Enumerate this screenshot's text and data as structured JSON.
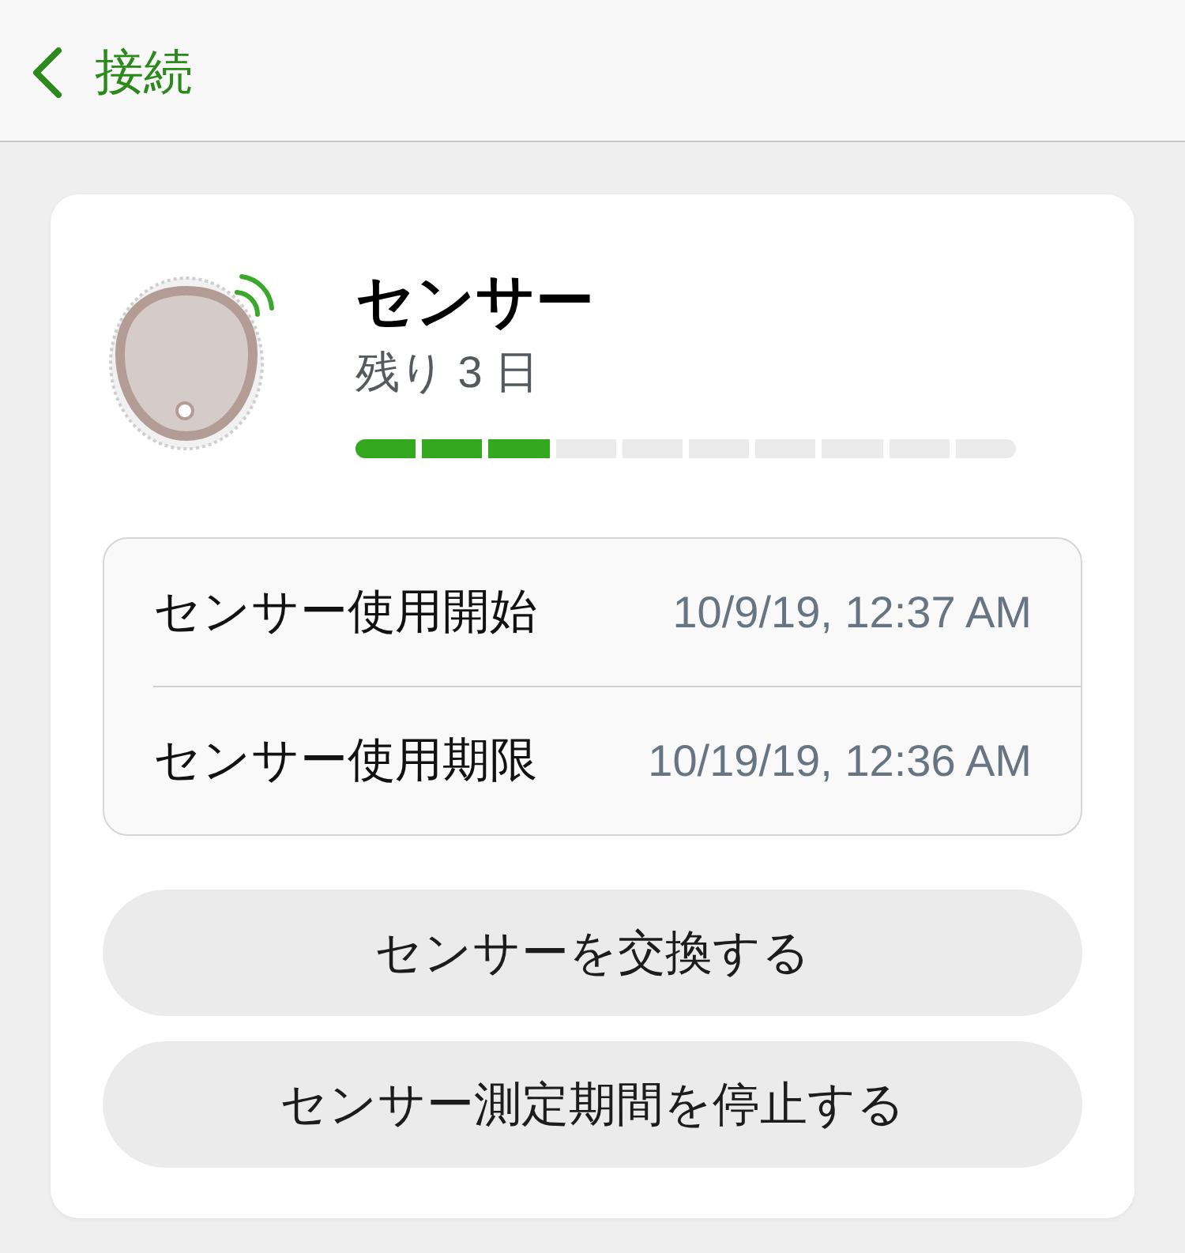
{
  "nav": {
    "back_label": "接続"
  },
  "sensor": {
    "title": "センサー",
    "remaining": "残り 3 日",
    "level": 0.3
  },
  "details": [
    {
      "label": "センサー使用開始",
      "value": "10/9/19, 12:37 AM"
    },
    {
      "label": "センサー使用期限",
      "value": "10/19/19, 12:36 AM"
    }
  ],
  "buttons": [
    {
      "label": "センサーを交換する"
    },
    {
      "label": "センサー測定期間を停止する"
    }
  ]
}
